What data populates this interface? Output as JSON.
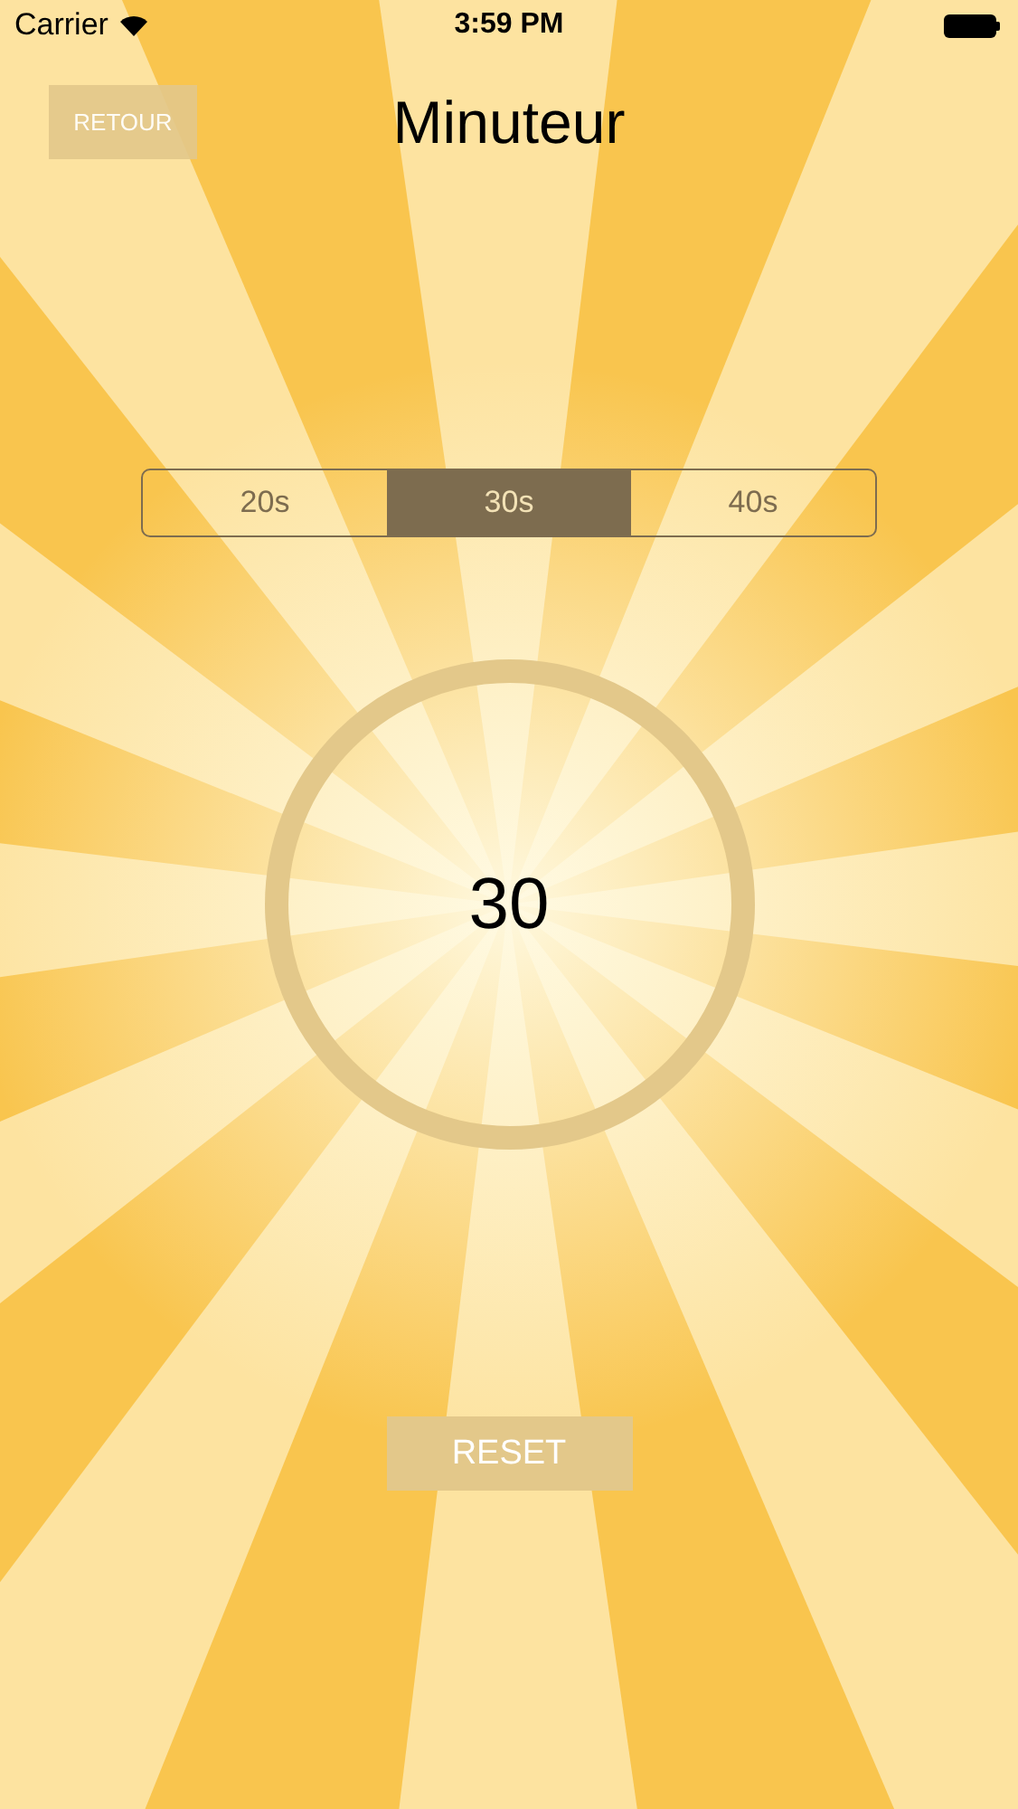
{
  "status_bar": {
    "carrier": "Carrier",
    "time": "3:59 PM"
  },
  "header": {
    "back_button": "RETOUR",
    "title": "Minuteur"
  },
  "durations": [
    {
      "label": "20s",
      "selected": false
    },
    {
      "label": "30s",
      "selected": true
    },
    {
      "label": "40s",
      "selected": false
    }
  ],
  "timer": {
    "value": "30"
  },
  "reset_button": "RESET"
}
